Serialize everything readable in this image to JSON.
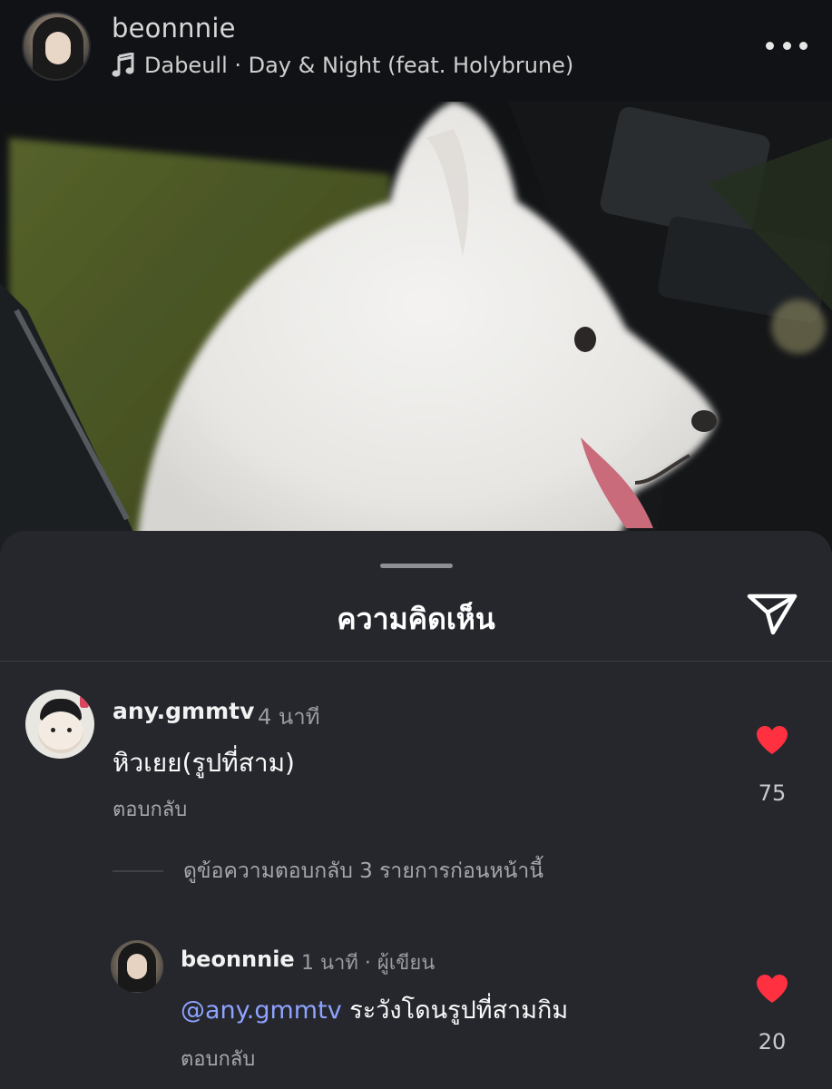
{
  "post": {
    "username": "beonnnie",
    "music": "Dabeull · Day & Night (feat. Holybrune)"
  },
  "comments_sheet": {
    "title": "ความคิดเห็น"
  },
  "comments": [
    {
      "username": "any.gmmtv",
      "time": "4 นาที",
      "text": "หิวเยย(รูปที่สาม)",
      "reply_label": "ตอบกลับ",
      "likes": "75"
    }
  ],
  "view_replies": "ดูข้อความตอบกลับ 3 รายการก่อนหน้านี้",
  "reply": {
    "username": "beonnnie",
    "meta": "1 นาที · ผู้เขียน",
    "mention": "@any.gmmtv",
    "text": " ระวังโดนรูปที่สามกิม",
    "reply_label": "ตอบกลับ",
    "likes": "20"
  },
  "colors": {
    "like_heart": "#ff3040",
    "mention": "#8ea2ff",
    "sheet_background": "#25272d"
  },
  "icons": [
    "music-note-icon",
    "more-options-icon",
    "send-icon",
    "heart-icon"
  ]
}
